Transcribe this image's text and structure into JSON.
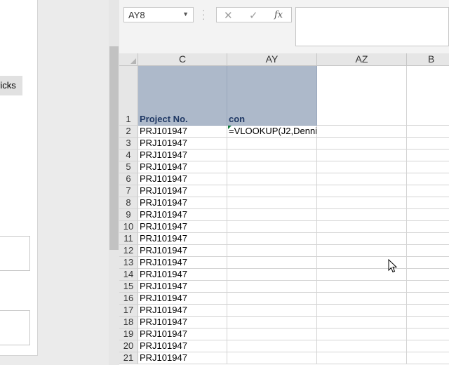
{
  "left_pane": {
    "chip_text": "ricks"
  },
  "name_box": {
    "value": "AY8"
  },
  "formula_bar": {
    "cancel_icon": "✕",
    "enter_icon": "✓",
    "fx_label": "fx",
    "content": ""
  },
  "columns": [
    "C",
    "AY",
    "AZ",
    "B"
  ],
  "header_row": {
    "row_number": "1",
    "C": "Project No.",
    "AY": "con"
  },
  "rows": [
    {
      "num": "2",
      "C": "PRJ101947",
      "AY": "=VLOOKUP(J2,Denni"
    },
    {
      "num": "3",
      "C": "PRJ101947",
      "AY": ""
    },
    {
      "num": "4",
      "C": "PRJ101947",
      "AY": ""
    },
    {
      "num": "5",
      "C": "PRJ101947",
      "AY": ""
    },
    {
      "num": "6",
      "C": "PRJ101947",
      "AY": ""
    },
    {
      "num": "7",
      "C": "PRJ101947",
      "AY": ""
    },
    {
      "num": "8",
      "C": "PRJ101947",
      "AY": ""
    },
    {
      "num": "9",
      "C": "PRJ101947",
      "AY": ""
    },
    {
      "num": "10",
      "C": "PRJ101947",
      "AY": ""
    },
    {
      "num": "11",
      "C": "PRJ101947",
      "AY": ""
    },
    {
      "num": "12",
      "C": "PRJ101947",
      "AY": ""
    },
    {
      "num": "13",
      "C": "PRJ101947",
      "AY": ""
    },
    {
      "num": "14",
      "C": "PRJ101947",
      "AY": ""
    },
    {
      "num": "15",
      "C": "PRJ101947",
      "AY": ""
    },
    {
      "num": "16",
      "C": "PRJ101947",
      "AY": ""
    },
    {
      "num": "17",
      "C": "PRJ101947",
      "AY": ""
    },
    {
      "num": "18",
      "C": "PRJ101947",
      "AY": ""
    },
    {
      "num": "19",
      "C": "PRJ101947",
      "AY": ""
    },
    {
      "num": "20",
      "C": "PRJ101947",
      "AY": ""
    },
    {
      "num": "21",
      "C": "PRJ101947",
      "AY": ""
    }
  ],
  "colors": {
    "header_fill": "#adb9ca",
    "header_text": "#1f3864",
    "error_marker": "#0f7b3c"
  }
}
